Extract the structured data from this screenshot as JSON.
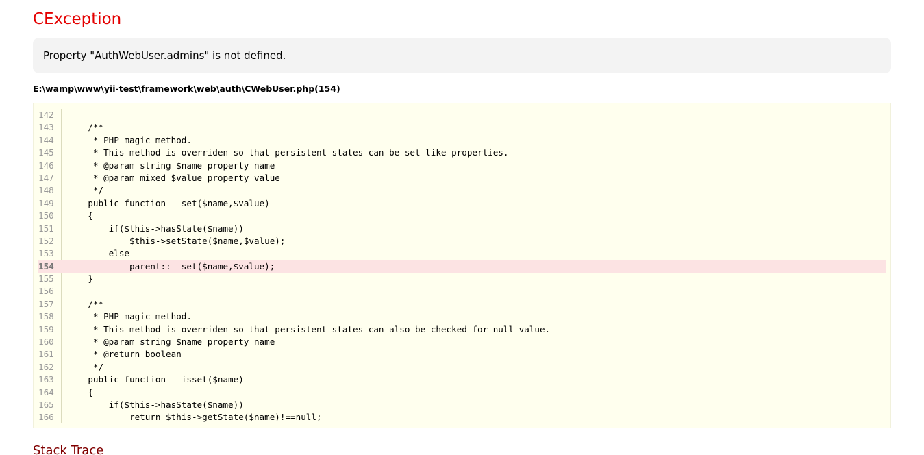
{
  "exception": {
    "title": "CException",
    "message": "Property \"AuthWebUser.admins\" is not defined.",
    "file": "E:\\wamp\\www\\yii-test\\framework\\web\\auth\\CWebUser.php(154)"
  },
  "source": {
    "error_line": "154",
    "lines": [
      {
        "num": "142",
        "code": ""
      },
      {
        "num": "143",
        "code": "    /**"
      },
      {
        "num": "144",
        "code": "     * PHP magic method."
      },
      {
        "num": "145",
        "code": "     * This method is overriden so that persistent states can be set like properties."
      },
      {
        "num": "146",
        "code": "     * @param string $name property name"
      },
      {
        "num": "147",
        "code": "     * @param mixed $value property value"
      },
      {
        "num": "148",
        "code": "     */"
      },
      {
        "num": "149",
        "code": "    public function __set($name,$value)"
      },
      {
        "num": "150",
        "code": "    {"
      },
      {
        "num": "151",
        "code": "        if($this->hasState($name))"
      },
      {
        "num": "152",
        "code": "            $this->setState($name,$value);"
      },
      {
        "num": "153",
        "code": "        else"
      },
      {
        "num": "154",
        "code": "            parent::__set($name,$value);"
      },
      {
        "num": "155",
        "code": "    }"
      },
      {
        "num": "156",
        "code": ""
      },
      {
        "num": "157",
        "code": "    /**"
      },
      {
        "num": "158",
        "code": "     * PHP magic method."
      },
      {
        "num": "159",
        "code": "     * This method is overriden so that persistent states can also be checked for null value."
      },
      {
        "num": "160",
        "code": "     * @param string $name property name"
      },
      {
        "num": "161",
        "code": "     * @return boolean"
      },
      {
        "num": "162",
        "code": "     */"
      },
      {
        "num": "163",
        "code": "    public function __isset($name)"
      },
      {
        "num": "164",
        "code": "    {"
      },
      {
        "num": "165",
        "code": "        if($this->hasState($name))"
      },
      {
        "num": "166",
        "code": "            return $this->getState($name)!==null;"
      }
    ]
  },
  "stack_trace": {
    "title": "Stack Trace"
  }
}
